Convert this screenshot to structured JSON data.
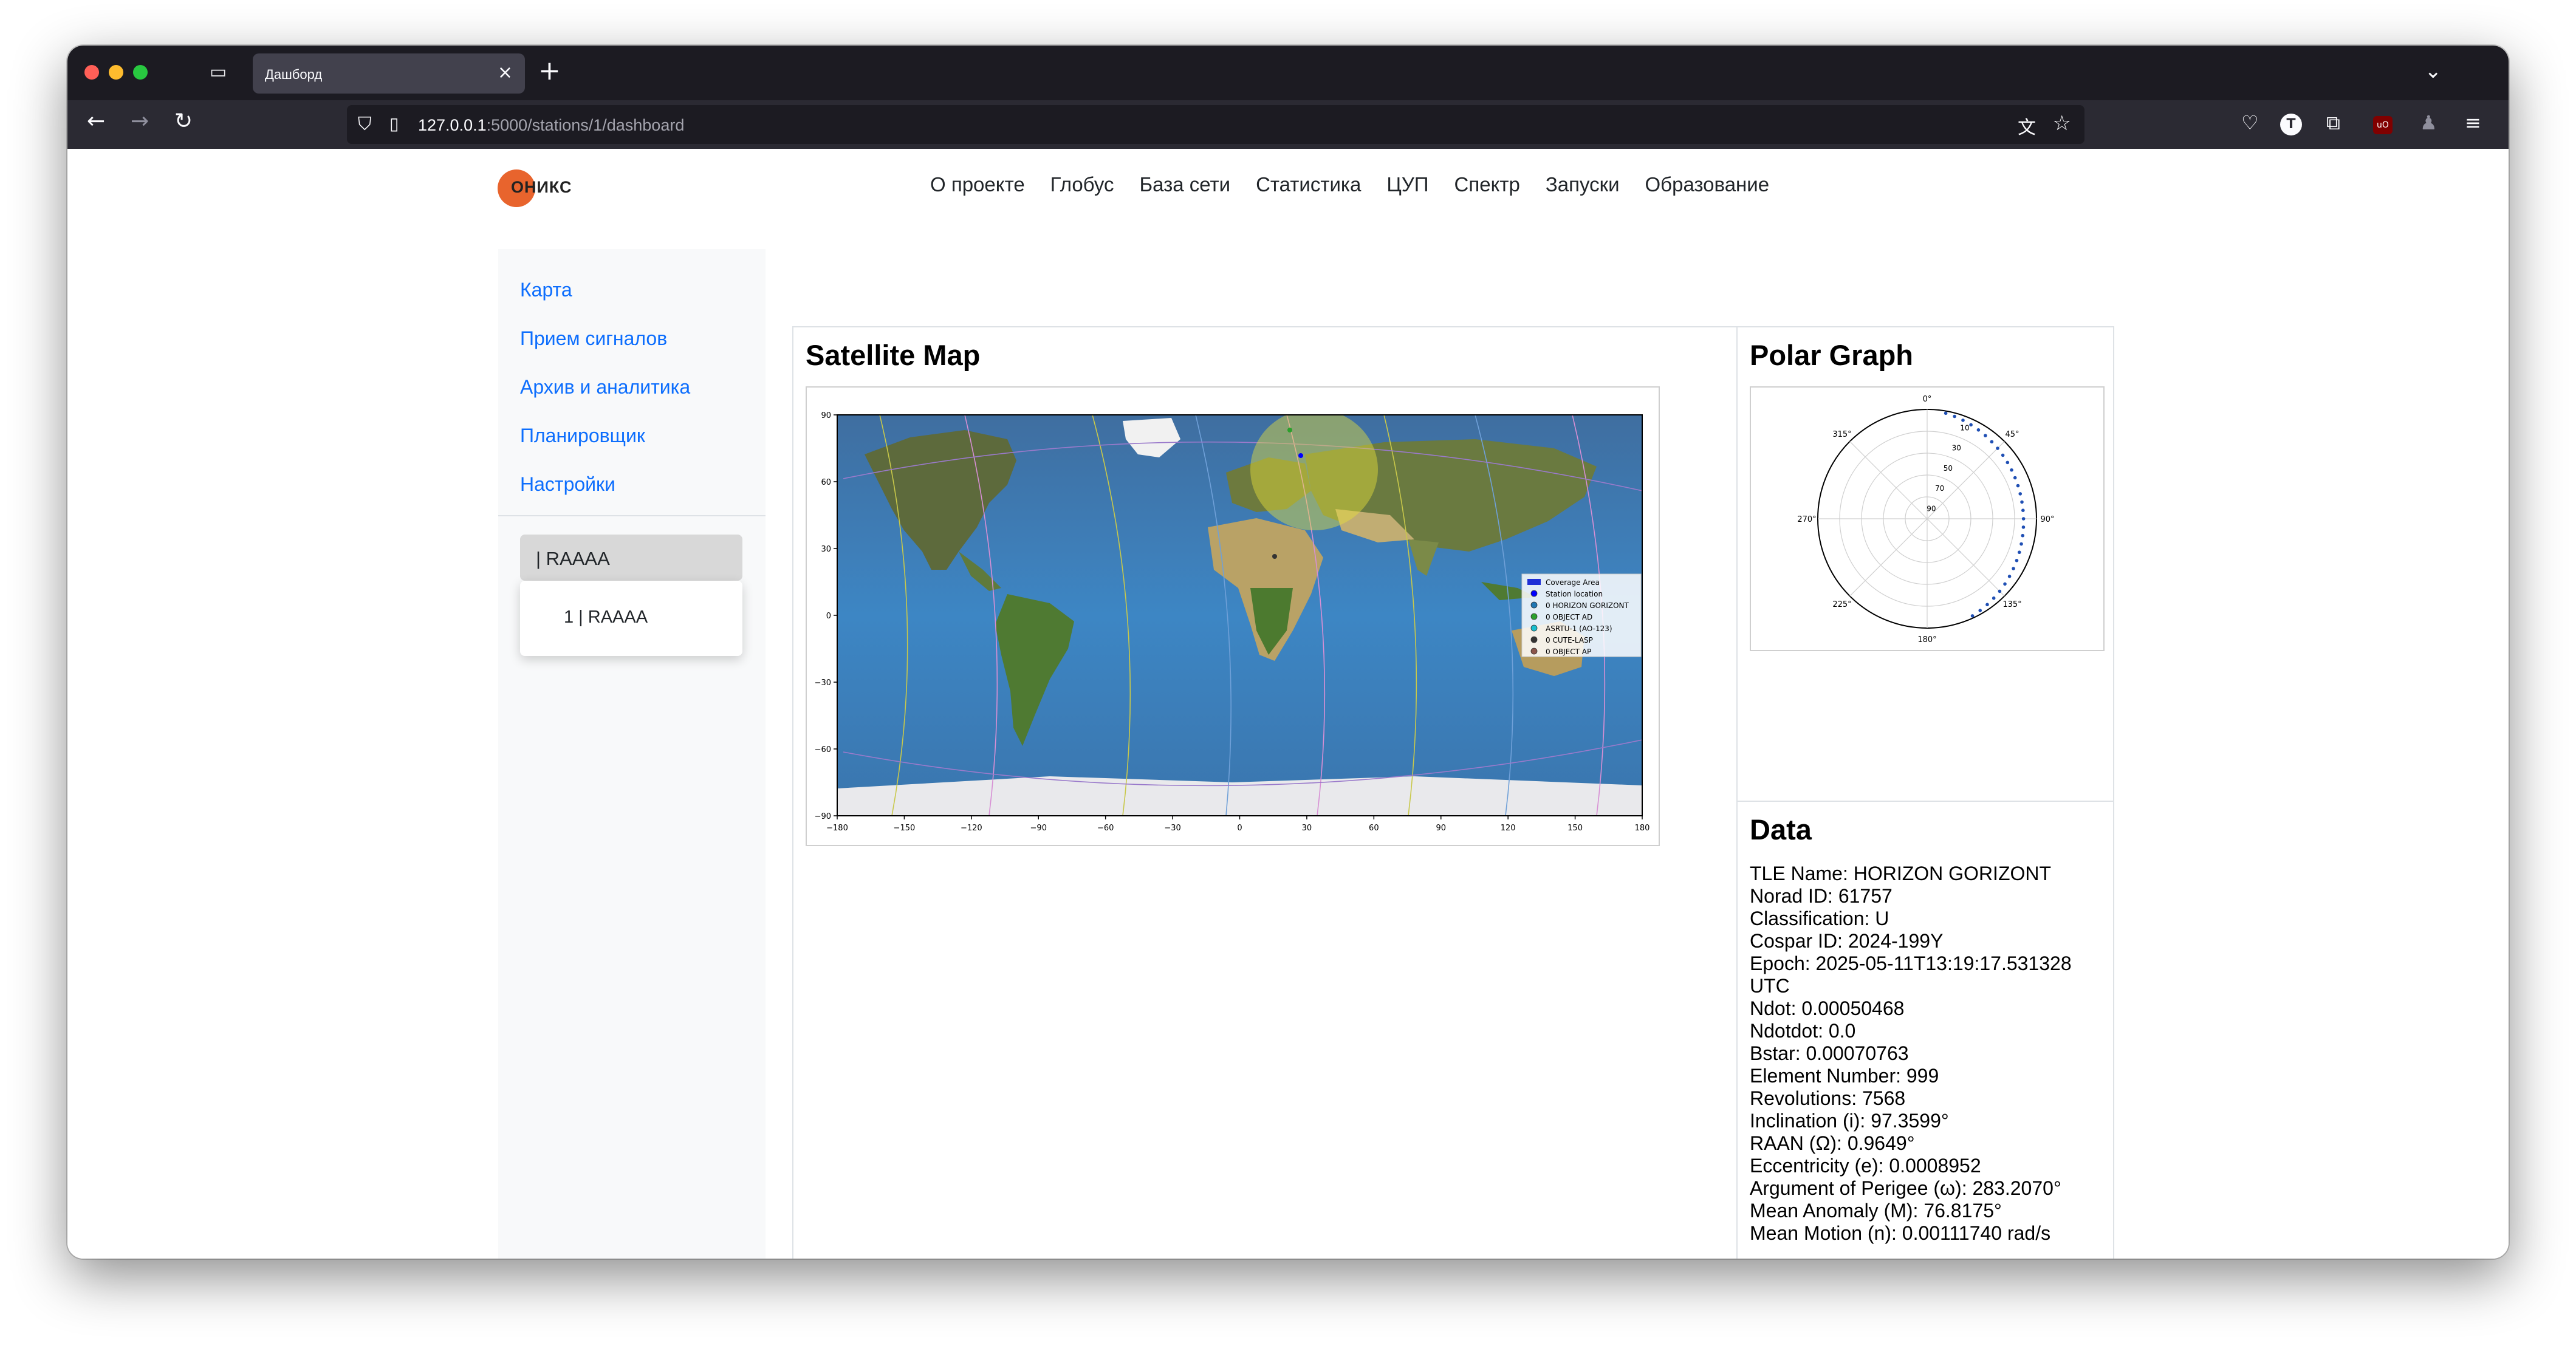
{
  "browser": {
    "tab_title": "Дашборд",
    "url_host": "127.0.0.1",
    "url_path": ":5000/stations/1/dashboard"
  },
  "site": {
    "logo_text": "ОНИКС",
    "nav": [
      "О проекте",
      "Глобус",
      "База сети",
      "Статистика",
      "ЦУП",
      "Спектр",
      "Запуски",
      "Образование"
    ]
  },
  "sidebar": {
    "links": [
      "Карта",
      "Прием сигналов",
      "Архив и аналитика",
      "Планировщик",
      "Настройки"
    ],
    "station_selected": "| RAAAA",
    "dropdown_option": "1 | RAAAA"
  },
  "satellite_map": {
    "title": "Satellite Map",
    "x_ticks": [
      "−180",
      "−150",
      "−120",
      "−90",
      "−60",
      "−30",
      "0",
      "30",
      "60",
      "90",
      "120",
      "150",
      "180"
    ],
    "y_ticks": [
      "90",
      "60",
      "30",
      "0",
      "−30",
      "−60",
      "−90"
    ],
    "legend": [
      {
        "label": "Coverage Area",
        "color": "#1f2fd6"
      },
      {
        "label": "Station location",
        "color": "#0000ff"
      },
      {
        "label": "0 HORIZON GORIZONT",
        "color": "#1f77b4"
      },
      {
        "label": "0 OBJECT AD",
        "color": "#2ca02c"
      },
      {
        "label": "ASRTU-1 (AO-123)",
        "color": "#17becf"
      },
      {
        "label": "0 CUTE-LASP",
        "color": "#333333"
      },
      {
        "label": "0 OBJECT AP",
        "color": "#8c564b"
      }
    ]
  },
  "polar_graph": {
    "title": "Polar Graph",
    "angle_labels": [
      "0°",
      "45°",
      "90°",
      "135°",
      "180°",
      "225°",
      "270°",
      "315°"
    ],
    "radial_labels": [
      "10",
      "30",
      "50",
      "70",
      "90"
    ]
  },
  "data_panel": {
    "title": "Data",
    "lines": [
      "TLE Name: HORIZON GORIZONT",
      "Norad ID: 61757",
      "Classification: U",
      "Cospar ID: 2024-199Y",
      "Epoch: 2025-05-11T13:19:17.531328",
      "UTC",
      "Ndot: 0.00050468",
      "Ndotdot: 0.0",
      "Bstar: 0.00070763",
      "Element Number: 999",
      "Revolutions: 7568",
      "Inclination (i): 97.3599°",
      "RAAN (Ω): 0.9649°",
      "Eccentricity (e): 0.0008952",
      "Argument of Perigee (ω): 283.2070°",
      "Mean Anomaly (M): 76.8175°",
      "Mean Motion (n): 0.00111740 rad/s"
    ]
  }
}
